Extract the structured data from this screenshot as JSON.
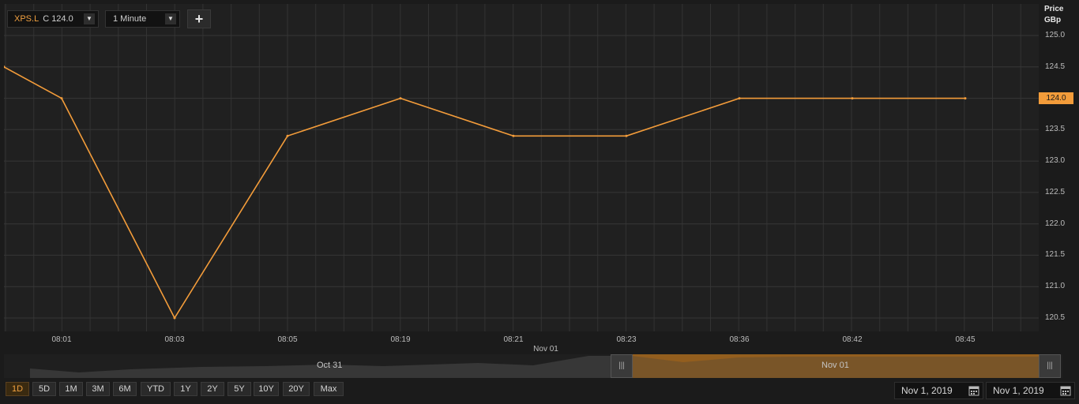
{
  "toolbar": {
    "symbol": "XPS.L",
    "quote": "C 124.0",
    "interval": "1 Minute",
    "add_label": "+"
  },
  "axis": {
    "price_label": "Price",
    "unit_label": "GBp",
    "last_value_label": "124.0",
    "date_label": "Nov 01"
  },
  "navigator": {
    "left_label": "Oct 31",
    "right_label": "Nov 01",
    "handle_label": "|||"
  },
  "ranges": [
    "1D",
    "5D",
    "1M",
    "3M",
    "6M",
    "YTD",
    "1Y",
    "2Y",
    "5Y",
    "10Y",
    "20Y",
    "Max"
  ],
  "active_range": "1D",
  "date_from": "Nov 1, 2019",
  "date_to": "Nov 1, 2019",
  "colors": {
    "line": "#f39c3a",
    "accent": "#f0a040",
    "navigator_selection": "#7a5020"
  },
  "chart_data": {
    "type": "line",
    "x": [
      "08:00",
      "08:01",
      "08:03",
      "08:05",
      "08:19",
      "08:21",
      "08:23",
      "08:36",
      "08:42",
      "08:45"
    ],
    "series": [
      {
        "values": [
          124.5,
          124.0,
          120.5,
          123.4,
          124.0,
          123.4,
          123.4,
          124.0,
          124.0,
          124.0
        ]
      }
    ],
    "x_ticks": [
      "08:01",
      "08:03",
      "08:05",
      "08:19",
      "08:21",
      "08:23",
      "08:36",
      "08:42",
      "08:45"
    ],
    "y_ticks": [
      "125.0",
      "124.5",
      "124.0",
      "123.5",
      "123.0",
      "122.5",
      "122.0",
      "121.5",
      "121.0",
      "120.5"
    ],
    "ylim": [
      120.35,
      125.3
    ],
    "grid": true
  }
}
